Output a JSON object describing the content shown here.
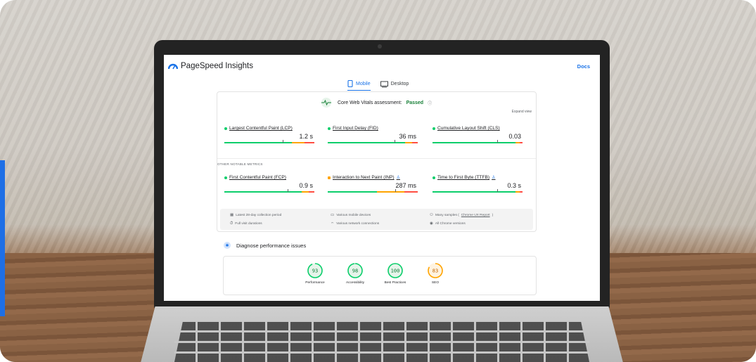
{
  "app": {
    "title": "PageSpeed Insights",
    "docs_label": "Docs"
  },
  "tabs": [
    {
      "label": "Mobile",
      "active": true,
      "icon": "phone-icon"
    },
    {
      "label": "Desktop",
      "active": false,
      "icon": "monitor-icon"
    }
  ],
  "cwv": {
    "assessment_label": "Core Web Vitals assessment:",
    "status": "Passed",
    "expand_label": "Expand view"
  },
  "core_metrics": [
    {
      "label": "Largest Contentful Paint (LCP)",
      "value": "1.2 s",
      "status": "good",
      "position": 0.65
    },
    {
      "label": "First Input Delay (FID)",
      "value": "36 ms",
      "status": "good",
      "position": 0.74
    },
    {
      "label": "Cumulative Layout Shift (CLS)",
      "value": "0.03",
      "status": "good",
      "position": 0.72
    }
  ],
  "other_metrics_heading": "OTHER NOTABLE METRICS",
  "other_metrics": [
    {
      "label": "First Contentful Paint (FCP)",
      "value": "0.9 s",
      "status": "good",
      "position": 0.7
    },
    {
      "label": "Interaction to Next Paint (INP)",
      "value": "287 ms",
      "status": "needs-improvement",
      "position": 0.75
    },
    {
      "label": "Time to First Byte (TTFB)",
      "value": "0.3 s",
      "status": "good",
      "position": 0.72
    }
  ],
  "info": {
    "period": "Latest 28-day collection period",
    "durations": "Full visit durations",
    "devices": "Various mobile devices",
    "connections": "Various network connections",
    "samples_prefix": "Many samples (",
    "samples_link": "Chrome UX Report",
    "samples_suffix": ")",
    "versions": "All Chrome versions"
  },
  "diagnose_label": "Diagnose performance issues",
  "scores": [
    {
      "label": "Performance",
      "value": "93",
      "fraction": 0.93,
      "color": "#0cce6b"
    },
    {
      "label": "Accessibility",
      "value": "98",
      "fraction": 0.98,
      "color": "#0cce6b"
    },
    {
      "label": "Best Practices",
      "value": "100",
      "fraction": 1.0,
      "color": "#0cce6b"
    },
    {
      "label": "SEO",
      "value": "83",
      "fraction": 0.83,
      "color": "#ffa400"
    }
  ],
  "colors": {
    "accent": "#1a73e8",
    "good": "#0cce6b",
    "average": "#ffa400",
    "poor": "#ff4e42"
  }
}
